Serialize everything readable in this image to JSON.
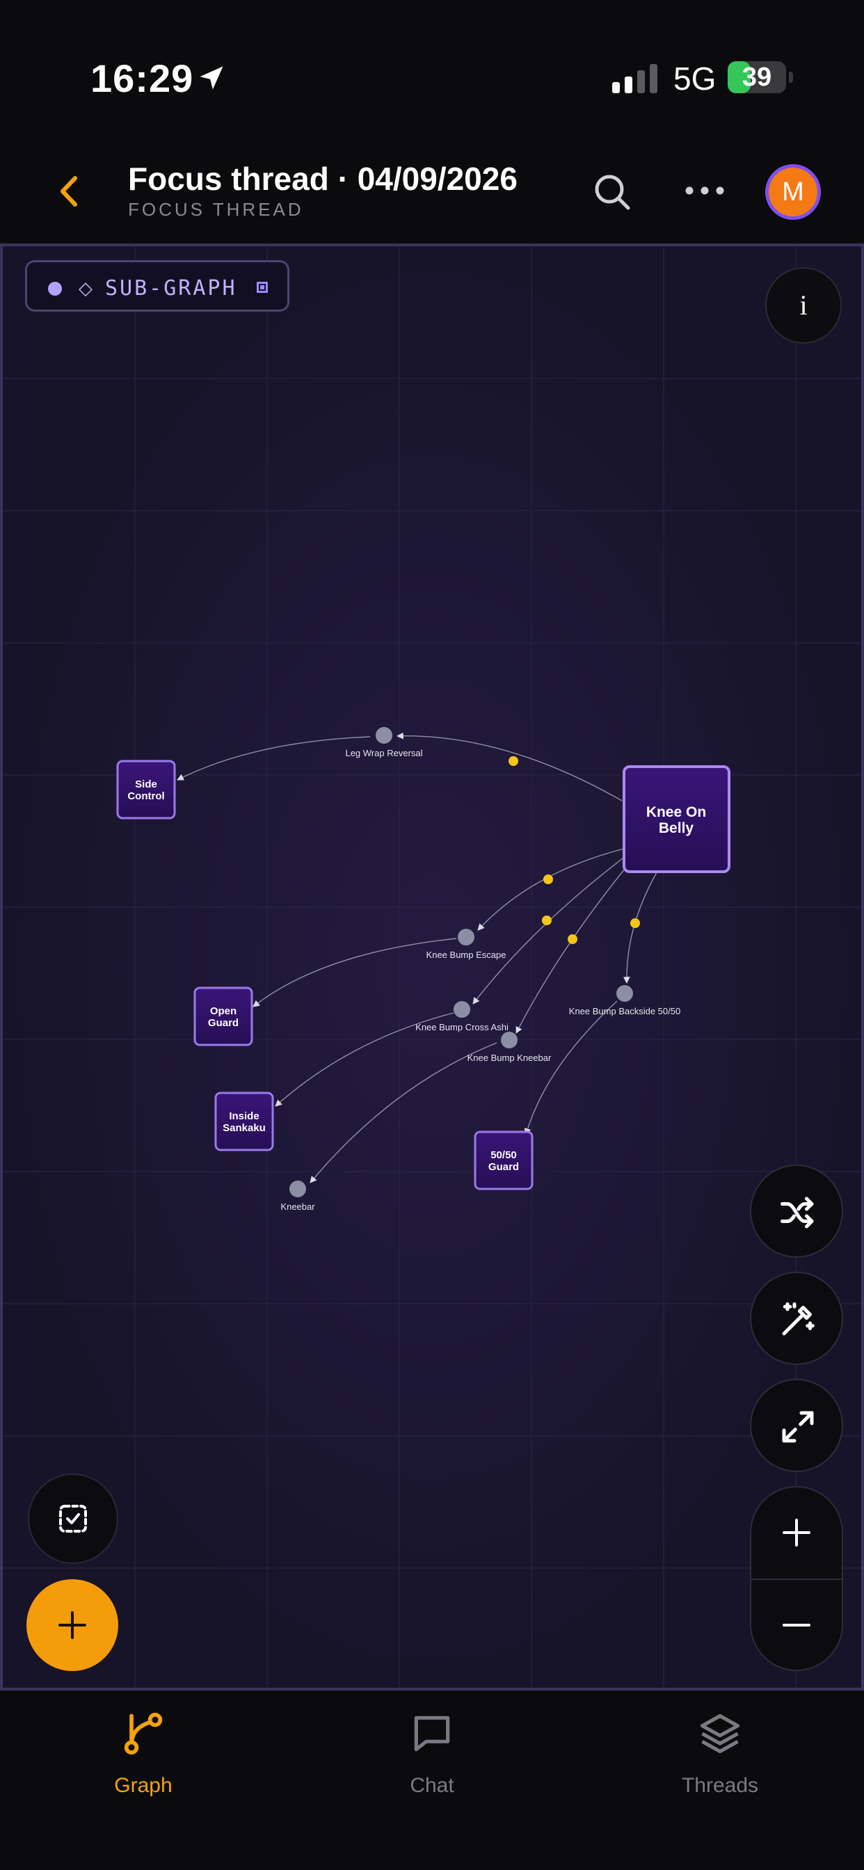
{
  "status_bar": {
    "time": "16:29",
    "network": "5G",
    "battery_level": "39",
    "battery_fraction": 0.39
  },
  "header": {
    "title": "Focus thread · 04/09/2026",
    "subtitle": "FOCUS THREAD",
    "avatar_initial": "M"
  },
  "canvas": {
    "subgraph_label": "SUB-GRAPH",
    "info_label": "i",
    "nodes": [
      {
        "id": "kob",
        "label": [
          "Knee On",
          "Belly"
        ],
        "primary": true
      },
      {
        "id": "side",
        "label": [
          "Side",
          "Control"
        ]
      },
      {
        "id": "open",
        "label": [
          "Open",
          "Guard"
        ]
      },
      {
        "id": "sankaku",
        "label": [
          "Inside",
          "Sankaku"
        ]
      },
      {
        "id": "fifty",
        "label": [
          "50/50",
          "Guard"
        ]
      }
    ],
    "edges": [
      {
        "label": "Leg Wrap Reversal",
        "from": "kob",
        "to": "side"
      },
      {
        "label": "Knee Bump Escape",
        "from": "kob",
        "to": "open"
      },
      {
        "label": "Knee Bump Cross Ashi",
        "from": "kob",
        "to": "sankaku"
      },
      {
        "label": "Knee Bump Kneebar",
        "from": "kob",
        "to": "kneebar"
      },
      {
        "label": "Knee Bump Backside 50/50",
        "from": "kob",
        "to": "fifty"
      }
    ],
    "terminal_labels": [
      "Kneebar"
    ]
  },
  "controls": {
    "shuffle": "shuffle-icon",
    "magic": "magic-wand-icon",
    "fit": "expand-icon",
    "zoom_in": "plus-icon",
    "zoom_out": "minus-icon",
    "select": "select-check-icon",
    "add": "plus-icon"
  },
  "tabs": [
    {
      "label": "Graph",
      "active": true,
      "icon": "graph-branch-icon"
    },
    {
      "label": "Chat",
      "active": false,
      "icon": "chat-bubble-icon"
    },
    {
      "label": "Threads",
      "active": false,
      "icon": "layers-icon"
    }
  ],
  "colors": {
    "accent": "#f5a30b",
    "node_fill": "#2e1466",
    "node_border": "#9a7be8",
    "edge_dot": "#f5c518",
    "waypoint": "#8c8ea4"
  }
}
